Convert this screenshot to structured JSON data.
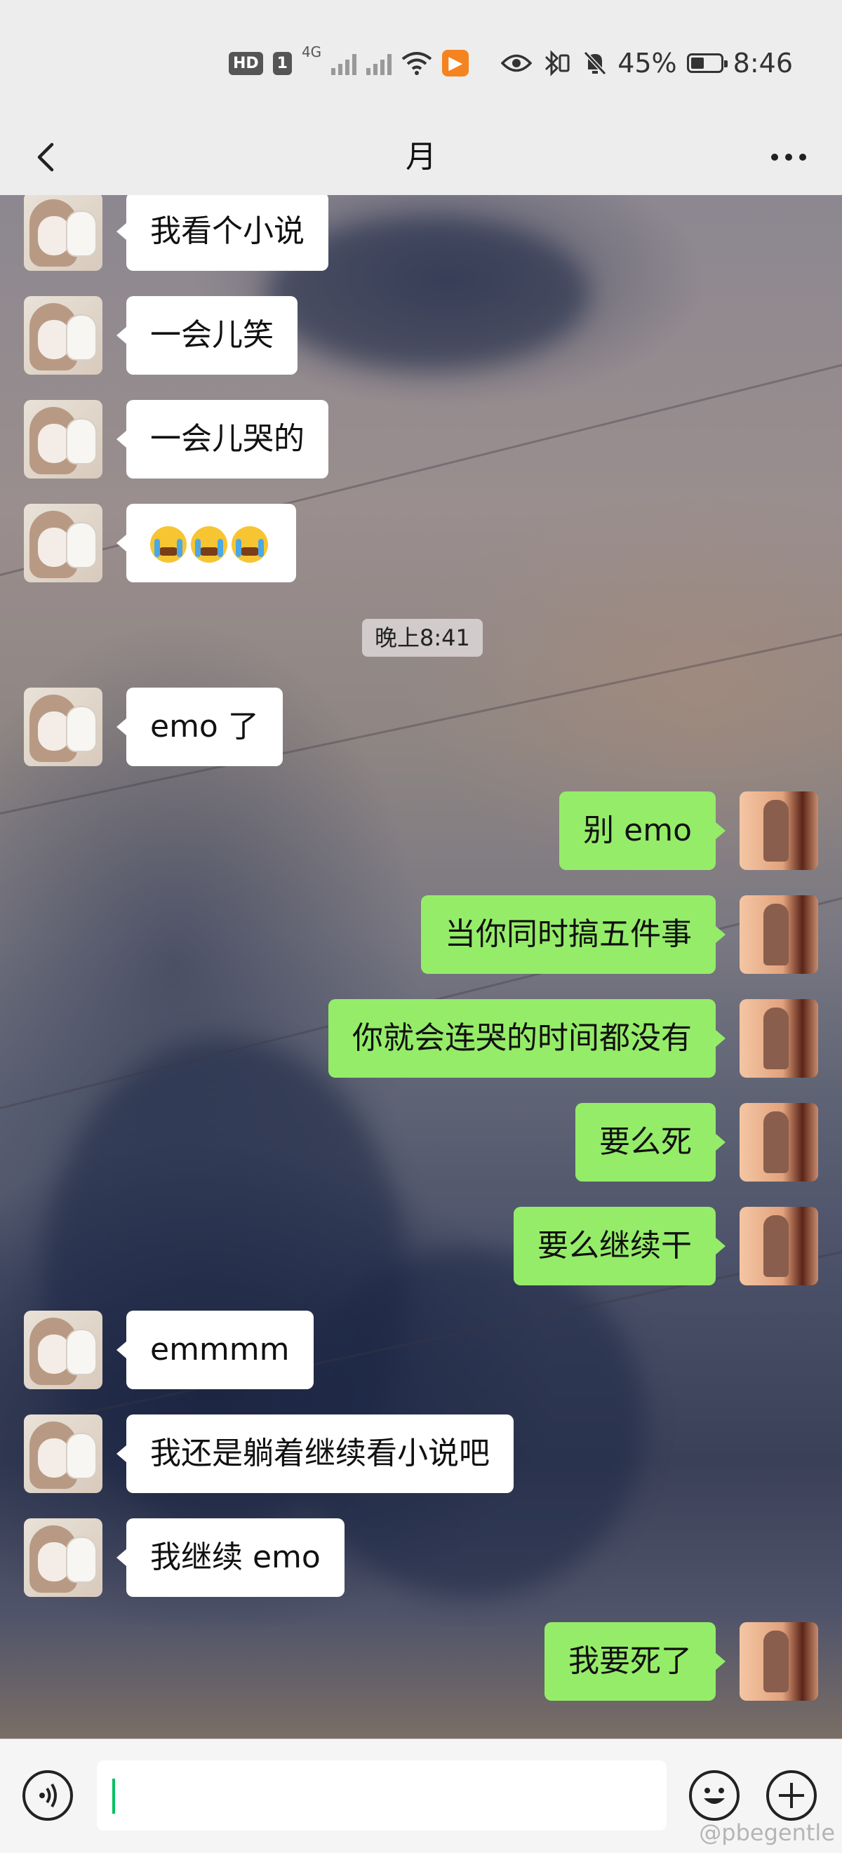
{
  "status_bar": {
    "hd": "HD",
    "sim": "1",
    "network": "4G",
    "battery_percent": "45%",
    "battery_level": 0.45,
    "time": "8:46"
  },
  "nav": {
    "title": "月"
  },
  "chat": {
    "timestamp": "晚上8:41",
    "messages": [
      {
        "side": "left",
        "text": "我看个小说"
      },
      {
        "side": "left",
        "text": "一会儿笑"
      },
      {
        "side": "left",
        "text": "一会儿哭的"
      },
      {
        "side": "left",
        "text": "",
        "emoji": [
          "crying-face",
          "crying-face",
          "crying-face"
        ]
      },
      {
        "side": "left",
        "text": "emo 了"
      },
      {
        "side": "right",
        "text": "别 emo"
      },
      {
        "side": "right",
        "text": "当你同时搞五件事"
      },
      {
        "side": "right",
        "text": "你就会连哭的时间都没有"
      },
      {
        "side": "right",
        "text": "要么死"
      },
      {
        "side": "right",
        "text": "要么继续干"
      },
      {
        "side": "left",
        "text": "emmmm"
      },
      {
        "side": "left",
        "text": "我还是躺着继续看小说吧"
      },
      {
        "side": "left",
        "text": "我继续 emo"
      },
      {
        "side": "right",
        "text": "我要死了"
      }
    ]
  },
  "input_bar": {
    "value": "",
    "icons": [
      "voice-icon",
      "emoji-icon",
      "plus-icon"
    ]
  },
  "watermark": "@pbegentle",
  "colors": {
    "sent_bubble": "#95ec69",
    "received_bubble": "#ffffff",
    "caret": "#07c160"
  }
}
